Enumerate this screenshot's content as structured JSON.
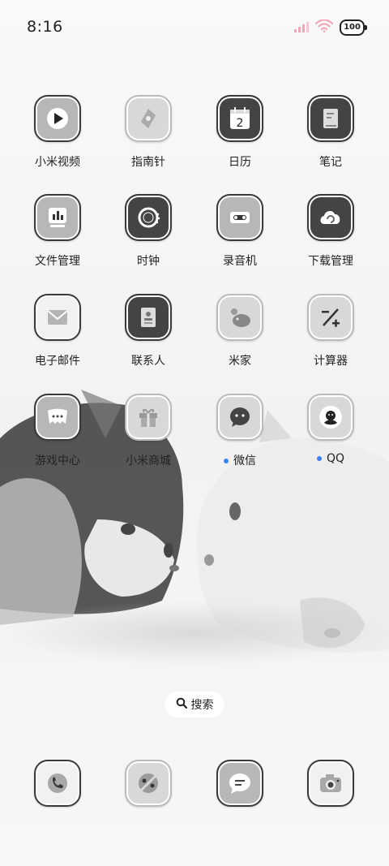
{
  "status_bar": {
    "time": "8:16",
    "battery": "100"
  },
  "apps": [
    {
      "label": "小米视频",
      "icon": "play-icon"
    },
    {
      "label": "指南针",
      "icon": "compass-icon"
    },
    {
      "label": "日历",
      "icon": "calendar-icon",
      "day": "2"
    },
    {
      "label": "笔记",
      "icon": "notes-icon"
    },
    {
      "label": "文件管理",
      "icon": "file-manager-icon"
    },
    {
      "label": "时钟",
      "icon": "clock-icon"
    },
    {
      "label": "录音机",
      "icon": "recorder-icon"
    },
    {
      "label": "下载管理",
      "icon": "download-cloud-icon"
    },
    {
      "label": "电子邮件",
      "icon": "mail-icon"
    },
    {
      "label": "联系人",
      "icon": "contacts-icon"
    },
    {
      "label": "米家",
      "icon": "mijia-icon"
    },
    {
      "label": "计算器",
      "icon": "calculator-icon"
    },
    {
      "label": "游戏中心",
      "icon": "game-center-icon"
    },
    {
      "label": "小米商城",
      "icon": "gift-icon"
    },
    {
      "label": "微信",
      "icon": "wechat-icon",
      "notification_dot": true
    },
    {
      "label": "QQ",
      "icon": "qq-penguin-icon",
      "notification_dot": true
    }
  ],
  "search": {
    "label": "搜索"
  },
  "dock": [
    {
      "icon": "phone-icon"
    },
    {
      "icon": "browser-icon"
    },
    {
      "icon": "messages-icon"
    },
    {
      "icon": "camera-icon"
    }
  ],
  "colors": {
    "notification_dot": "#3b82f6",
    "signal": "#f2a6b9"
  }
}
